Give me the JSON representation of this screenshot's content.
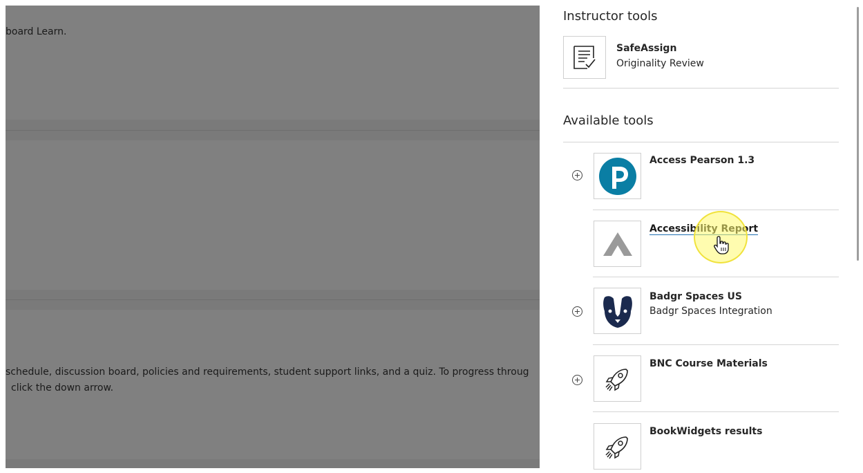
{
  "background": {
    "line1": "board Learn.",
    "line2": "schedule, discussion board, policies and requirements, student support links, and a quiz. To progress throug",
    "line3": "click the down arrow."
  },
  "panel": {
    "instructor_heading": "Instructor tools",
    "instructor_tools": [
      {
        "name": "SafeAssign",
        "desc": "Originality Review",
        "icon": "document-check-icon"
      }
    ],
    "available_heading": "Available tools",
    "available_tools": [
      {
        "name": "Access Pearson 1.3",
        "desc": "",
        "icon": "pearson-logo-icon"
      },
      {
        "name": "Accessibility Report",
        "desc": "",
        "icon": "accessibility-report-logo-icon"
      },
      {
        "name": "Badgr Spaces US",
        "desc": "Badgr Spaces Integration",
        "icon": "badger-logo-icon"
      },
      {
        "name": "BNC Course Materials",
        "desc": "",
        "icon": "rocket-icon"
      },
      {
        "name": "BookWidgets results",
        "desc": "",
        "icon": "rocket-icon"
      }
    ]
  },
  "colors": {
    "overlay": "#7a7a7a",
    "pearson": "#0a7ea4",
    "badger": "#1b2a4e",
    "link_underline": "#1e6fb0",
    "cursor_highlight": "#fff86e"
  }
}
